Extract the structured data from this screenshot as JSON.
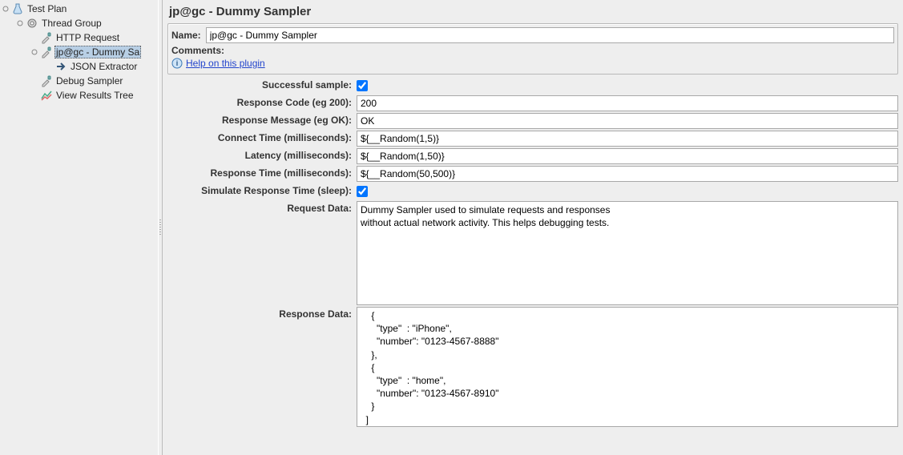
{
  "tree": {
    "root": {
      "label": "Test Plan"
    },
    "thread_group": {
      "label": "Thread Group"
    },
    "http_request": {
      "label": "HTTP Request"
    },
    "dummy": {
      "label": "jp@gc - Dummy Sa"
    },
    "json_ext": {
      "label": "JSON Extractor"
    },
    "debug": {
      "label": "Debug Sampler"
    },
    "results": {
      "label": "View Results Tree"
    }
  },
  "panel": {
    "title": "jp@gc - Dummy Sampler",
    "name_label": "Name:",
    "name_value": "jp@gc - Dummy Sampler",
    "comments_label": "Comments:",
    "help_link": "Help on this plugin"
  },
  "form": {
    "successful_label": "Successful sample:",
    "successful_checked": true,
    "response_code_label": "Response Code (eg 200):",
    "response_code_value": "200",
    "response_message_label": "Response Message (eg OK):",
    "response_message_value": "OK",
    "connect_time_label": "Connect Time (milliseconds):",
    "connect_time_value": "${__Random(1,5)}",
    "latency_label": "Latency (milliseconds):",
    "latency_value": "${__Random(1,50)}",
    "response_time_label": "Response Time (milliseconds):",
    "response_time_value": "${__Random(50,500)}",
    "simulate_sleep_label": "Simulate Response Time (sleep):",
    "simulate_sleep_checked": true,
    "request_data_label": "Request Data:",
    "request_data_value": "Dummy Sampler used to simulate requests and responses\nwithout actual network activity. This helps debugging tests.",
    "response_data_label": "Response Data:",
    "response_data_value": "    {\n      \"type\"  : \"iPhone\",\n      \"number\": \"0123-4567-8888\"\n    },\n    {\n      \"type\"  : \"home\",\n      \"number\": \"0123-4567-8910\"\n    }\n  ]\n}"
  }
}
